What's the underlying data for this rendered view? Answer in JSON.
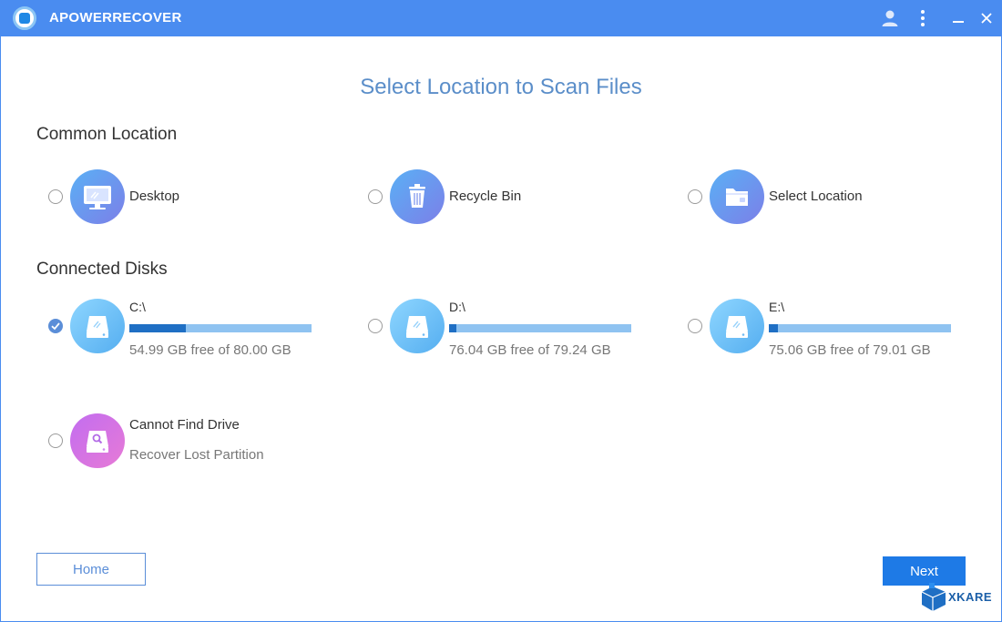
{
  "window": {
    "title": "APOWERRECOVER",
    "icons": [
      "user-icon",
      "more-vertical-icon",
      "minimize-icon",
      "close-icon"
    ]
  },
  "page": {
    "title": "Select Location to Scan Files"
  },
  "common_location": {
    "heading": "Common Location",
    "items": [
      {
        "label": "Desktop",
        "icon": "desktop-icon",
        "selected": false
      },
      {
        "label": "Recycle Bin",
        "icon": "recycle-bin-icon",
        "selected": false
      },
      {
        "label": "Select Location",
        "icon": "folder-icon",
        "selected": false
      }
    ]
  },
  "connected_disks": {
    "heading": "Connected Disks",
    "drives": [
      {
        "name": "C:\\",
        "free_text": "54.99 GB free of 80.00 GB",
        "used_fraction": 0.31,
        "selected": true
      },
      {
        "name": "D:\\",
        "free_text": "76.04 GB free of 79.24 GB",
        "used_fraction": 0.04,
        "selected": false
      },
      {
        "name": "E:\\",
        "free_text": "75.06 GB free of 79.01 GB",
        "used_fraction": 0.05,
        "selected": false
      }
    ],
    "cannot_find": {
      "label": "Cannot Find Drive",
      "sublabel": "Recover Lost Partition",
      "selected": false
    }
  },
  "buttons": {
    "home": "Home",
    "next": "Next"
  },
  "watermark": {
    "text": "XKARE"
  },
  "colors": {
    "titlebar": "#4a8cf0",
    "accent": "#1e7ae6",
    "title_text": "#5b8ec9",
    "bar_track": "#8fc3f1",
    "bar_fill": "#1f6fc4"
  }
}
